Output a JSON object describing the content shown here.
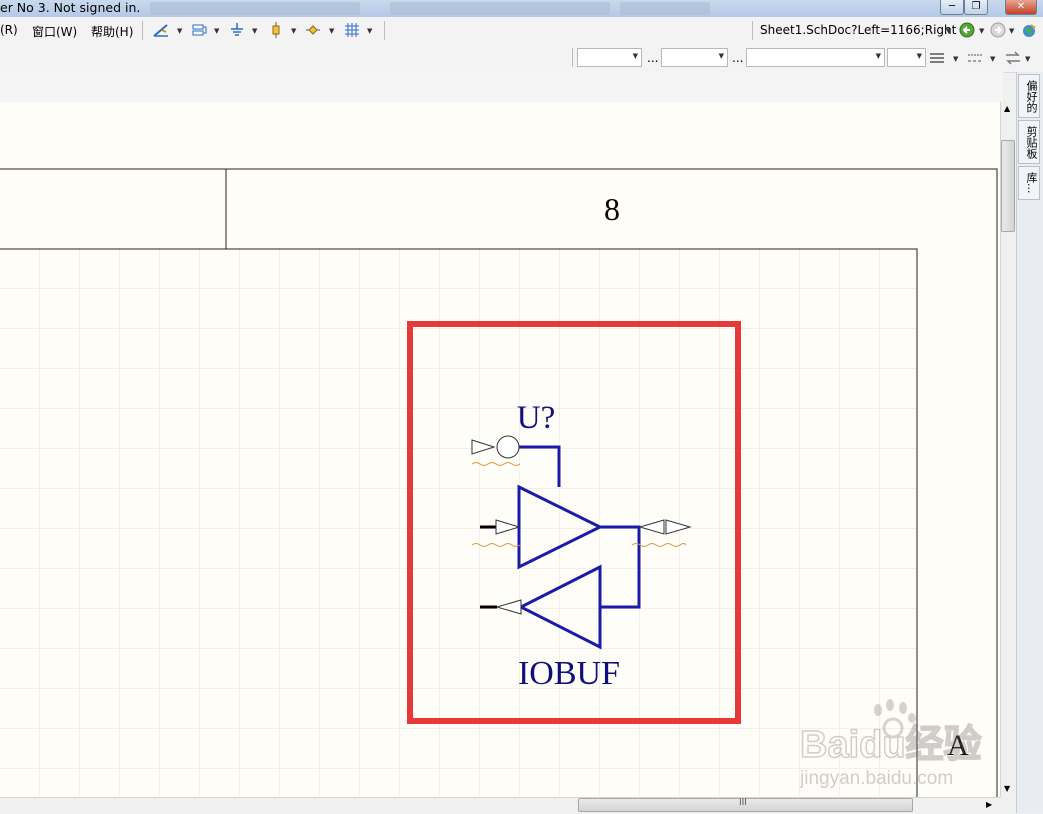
{
  "titlebar": {
    "text": "er No 3. Not signed in."
  },
  "menu": {
    "items": [
      "(R)",
      "窗口(W)",
      "帮助(H)"
    ]
  },
  "toolbar": {
    "sheet_title": "Sheet1.SchDoc?Left=1166;Right"
  },
  "toolbar2": {
    "ellipsis": "..."
  },
  "sidebar": {
    "tabs": [
      "偏好的",
      "剪贴板",
      "库..."
    ]
  },
  "schematic": {
    "zone_number": "8",
    "zone_letter": "A",
    "designator": "U?",
    "component_name": "IOBUF",
    "component_color": "#10107a",
    "highlight_color": "#e8393a"
  },
  "watermark": {
    "brand": "Baidu经验",
    "url": "jingyan.baidu.com"
  },
  "scrollbar": {
    "grip": "III"
  },
  "colors": {
    "canvas": "#fffdf7",
    "wire": "#1b1ba8"
  }
}
